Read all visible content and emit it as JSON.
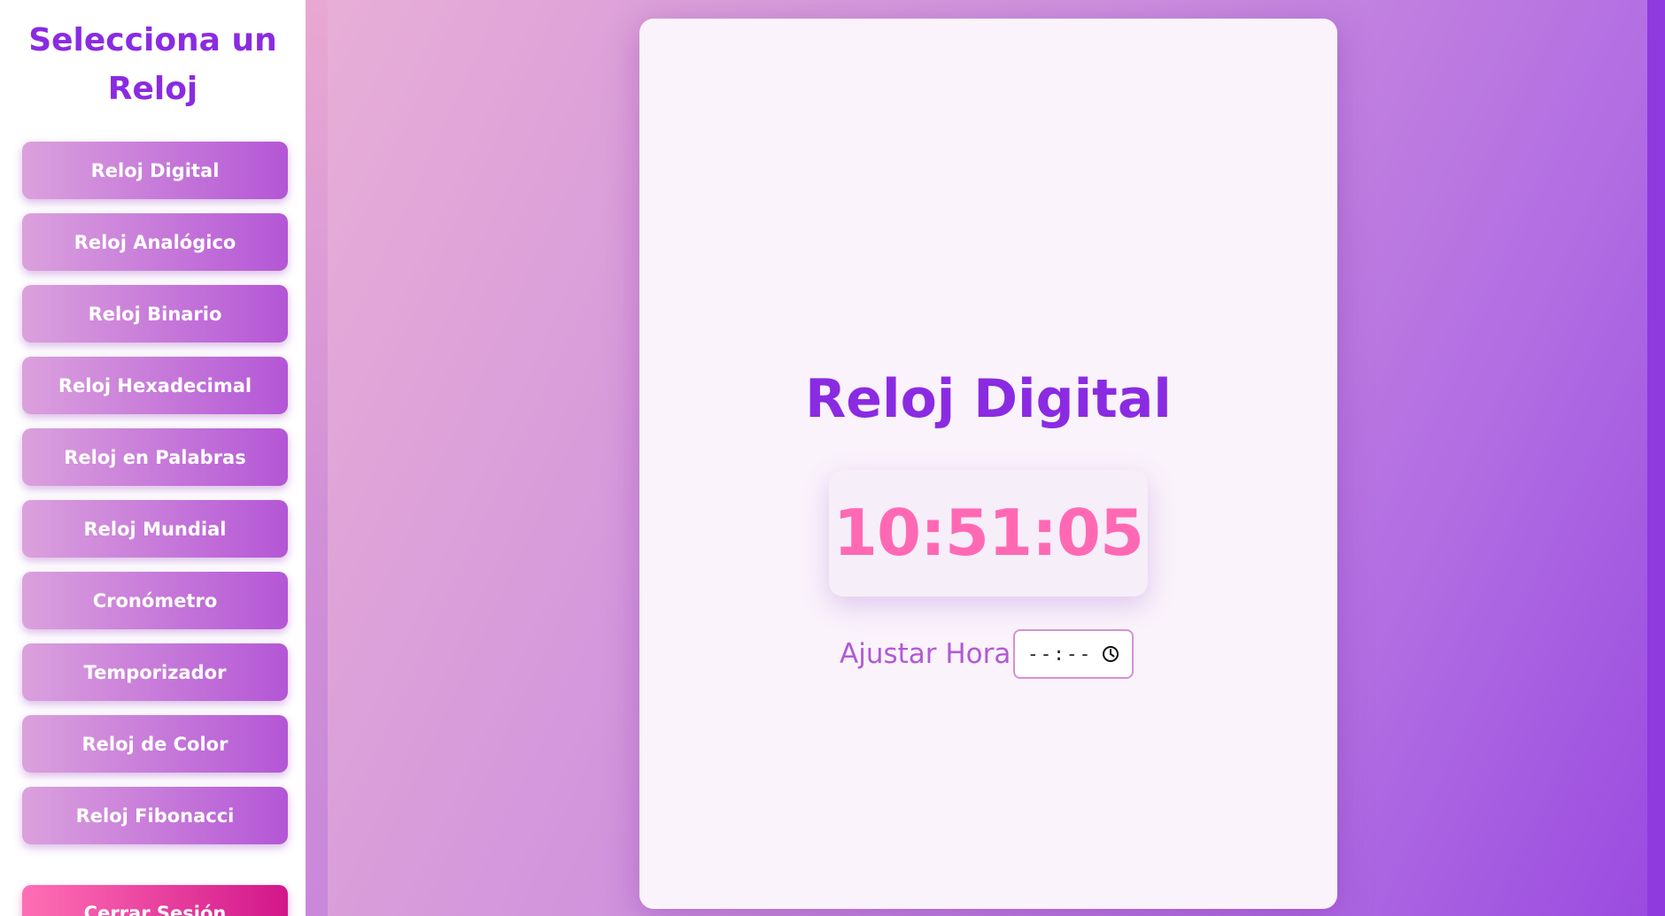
{
  "sidebar": {
    "title": "Selecciona un Reloj",
    "items": [
      {
        "label": "Reloj Digital"
      },
      {
        "label": "Reloj Analógico"
      },
      {
        "label": "Reloj Binario"
      },
      {
        "label": "Reloj Hexadecimal"
      },
      {
        "label": "Reloj en Palabras"
      },
      {
        "label": "Reloj Mundial"
      },
      {
        "label": "Cronómetro"
      },
      {
        "label": "Temporizador"
      },
      {
        "label": "Reloj de Color"
      },
      {
        "label": "Reloj Fibonacci"
      }
    ],
    "logout_label": "Cerrar Sesión"
  },
  "main": {
    "title": "Reloj Digital",
    "time": "10:51:05",
    "adjust_label": "Ajustar Hora:",
    "time_input_placeholder": "--:--",
    "time_input_icon": "clock-icon"
  },
  "colors": {
    "accent_purple": "#8a2be2",
    "time_pink": "#ff69b4",
    "logout_pink": "#d3178a"
  }
}
